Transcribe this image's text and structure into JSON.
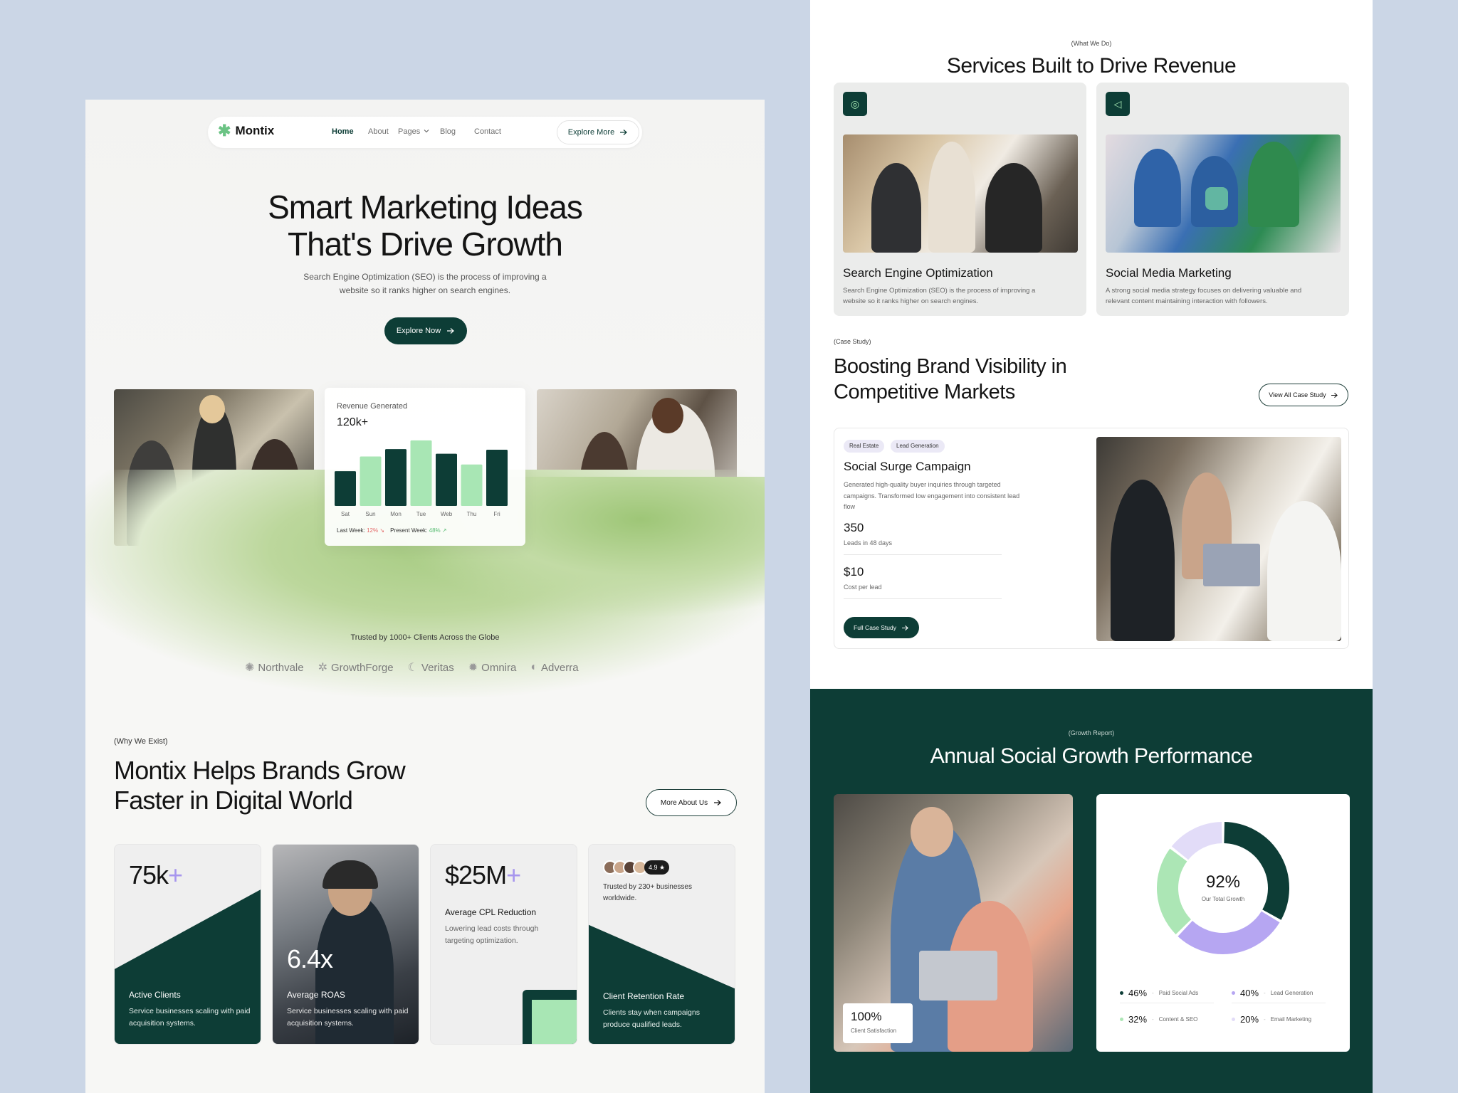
{
  "left_page": {
    "nav": {
      "logo": "Montix",
      "links": [
        "Home",
        "About",
        "Pages",
        "Blog",
        "Contact"
      ],
      "cta": "Explore More"
    },
    "hero": {
      "title_line1": "Smart Marketing Ideas",
      "title_line2": "That's Drive Growth",
      "subtitle": "Search Engine Optimization (SEO) is the process of improving a website so it ranks higher on search engines.",
      "cta": "Explore Now"
    },
    "revenue_card": {
      "label": "Revenue Generated",
      "value": "120k+",
      "last_week_label": "Last Week:",
      "last_week_value": "12%",
      "present_week_label": "Present Week:",
      "present_week_value": "48%"
    },
    "trusted": {
      "text": "Trusted by 1000+ Clients Across the Globe",
      "brands": [
        "Northvale",
        "GrowthForge",
        "Veritas",
        "Omnira",
        "Adverra"
      ]
    },
    "why": {
      "tag": "(Why We Exist)",
      "title_line1": "Montix Helps Brands Grow",
      "title_line2": "Faster in Digital World",
      "cta": "More About Us"
    },
    "stats": {
      "active_clients": {
        "value": "75k",
        "plus": "+",
        "title": "Active Clients",
        "desc": "Service businesses scaling with paid acquisition systems."
      },
      "roas": {
        "value": "6.4x",
        "title": "Average ROAS",
        "desc": "Service businesses scaling with paid acquisition systems."
      },
      "cpl": {
        "value": "$25M",
        "plus": "+",
        "title": "Average CPL Reduction",
        "desc": "Lowering lead costs through targeting optimization."
      },
      "retention": {
        "rating": "4.9",
        "trusted": "Trusted by 230+ businesses worldwide.",
        "title": "Client Retention Rate",
        "desc": "Clients stay when campaigns produce qualified leads."
      }
    }
  },
  "right_page": {
    "services": {
      "tag": "(What We Do)",
      "title": "Services Built to Drive Revenue",
      "items": [
        {
          "name": "Search Engine Optimization",
          "desc": "Search Engine Optimization (SEO) is the process of improving a website so it ranks higher on search engines."
        },
        {
          "name": "Social Media Marketing",
          "desc": "A strong social media strategy focuses on delivering valuable and relevant content maintaining interaction with followers."
        }
      ]
    },
    "case_study": {
      "tag": "(Case Study)",
      "title_line1": "Boosting Brand Visibility in",
      "title_line2": "Competitive Markets",
      "view_all": "View All Case Study",
      "chips": [
        "Real Estate",
        "Lead Generation"
      ],
      "name": "Social Surge Campaign",
      "desc": "Generated high-quality buyer inquiries through targeted campaigns. Transformed low engagement into consistent lead flow",
      "metrics": [
        {
          "value": "350",
          "label": "Leads in 48 days"
        },
        {
          "value": "$10",
          "label": "Cost per lead"
        }
      ],
      "cta": "Full Case Study"
    },
    "growth": {
      "tag": "(Growth Report)",
      "title": "Annual Social Growth Performance",
      "satisfaction_value": "100%",
      "satisfaction_label": "Client Satisfaction",
      "donut_value": "92%",
      "donut_label": "Our Total Growth"
    }
  },
  "colors": {
    "brand_dark": "#0d3d36",
    "brand_green": "#a8e6b4",
    "accent_purple": "#a796ee",
    "page_bg": "#cbd6e6"
  },
  "chart_data": [
    {
      "type": "bar",
      "title": "Revenue Generated",
      "categories": [
        "Sat",
        "Sun",
        "Mon",
        "Tue",
        "Web",
        "Thu",
        "Fri"
      ],
      "values": [
        52,
        74,
        85,
        98,
        78,
        62,
        84
      ],
      "colors": [
        "#0d3d36",
        "#a8e6b4",
        "#0d3d36",
        "#a8e6b4",
        "#0d3d36",
        "#a8e6b4",
        "#0d3d36"
      ],
      "ylim": [
        0,
        100
      ]
    },
    {
      "type": "pie",
      "center_label": "92%",
      "slices": [
        {
          "label": "Paid Social Ads",
          "value": 46,
          "color": "#0d3d36"
        },
        {
          "label": "Lead Generation",
          "value": 40,
          "color": "#b6a6f2"
        },
        {
          "label": "Content & SEO",
          "value": 32,
          "color": "#ace6b5"
        },
        {
          "label": "Email Marketing",
          "value": 20,
          "color": "#e2dcf8"
        }
      ],
      "legend_values": [
        "46%",
        "40%",
        "32%",
        "20%"
      ]
    }
  ]
}
